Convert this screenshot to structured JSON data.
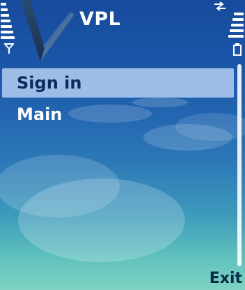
{
  "app": {
    "title": "VPL"
  },
  "menu": {
    "items": [
      {
        "label": "Sign in",
        "selected": true
      },
      {
        "label": "Main",
        "selected": false
      }
    ]
  },
  "softkeys": {
    "right": "Exit"
  },
  "status": {
    "signal_icon": "signal-bars-icon",
    "battery_icon": "battery-bars-icon",
    "connectivity_icon": "data-transfer-icon"
  },
  "colors": {
    "selection": "#a8c4ec",
    "background_top": "#164a9c",
    "background_bottom": "#7fd3c3",
    "text": "#0a2a4a"
  }
}
